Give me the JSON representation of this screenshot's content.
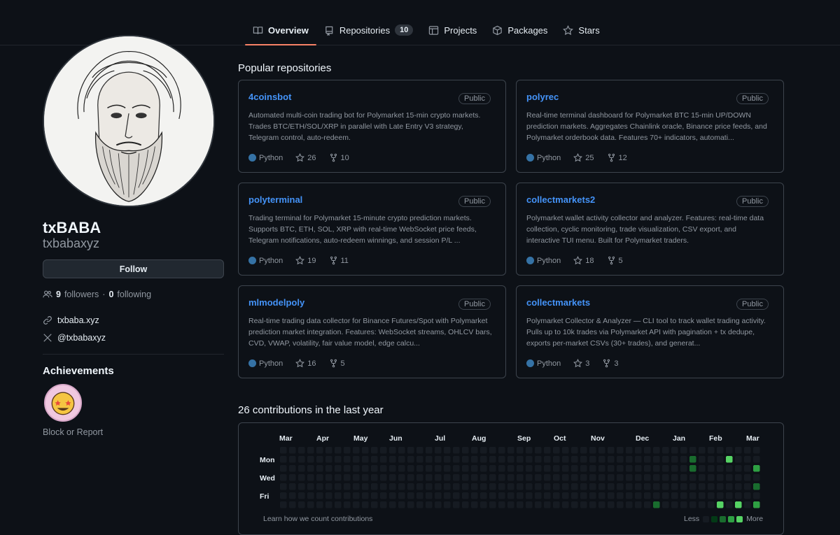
{
  "tabs": [
    {
      "label": "Overview",
      "icon": "book-icon",
      "active": true
    },
    {
      "label": "Repositories",
      "icon": "repo-icon",
      "count": "10"
    },
    {
      "label": "Projects",
      "icon": "table-icon"
    },
    {
      "label": "Packages",
      "icon": "package-icon"
    },
    {
      "label": "Stars",
      "icon": "star-icon"
    }
  ],
  "profile": {
    "name": "txBABA",
    "login": "txbabaxyz",
    "follow_label": "Follow",
    "followers_count": "9",
    "followers_label": "followers",
    "separator": "·",
    "following_count": "0",
    "following_label": "following",
    "website": "txbaba.xyz",
    "twitter": "@txbabaxyz",
    "achievements_title": "Achievements",
    "block_label": "Block or Report"
  },
  "popular_title": "Popular repositories",
  "repos": [
    {
      "name": "4coinsbot",
      "visibility": "Public",
      "description": "Automated multi-coin trading bot for Polymarket 15-min crypto markets. Trades BTC/ETH/SOL/XRP in parallel with Late Entry V3 strategy, Telegram control, auto-redeem.",
      "language": "Python",
      "stars": "26",
      "forks": "10"
    },
    {
      "name": "polyrec",
      "visibility": "Public",
      "description": "Real-time terminal dashboard for Polymarket BTC 15-min UP/DOWN prediction markets. Aggregates Chainlink oracle, Binance price feeds, and Polymarket orderbook data. Features 70+ indicators, automati...",
      "language": "Python",
      "stars": "25",
      "forks": "12"
    },
    {
      "name": "polyterminal",
      "visibility": "Public",
      "description": "Trading terminal for Polymarket 15-minute crypto prediction markets. Supports BTC, ETH, SOL, XRP with real-time WebSocket price feeds, Telegram notifications, auto-redeem winnings, and session P/L ...",
      "language": "Python",
      "stars": "19",
      "forks": "11"
    },
    {
      "name": "collectmarkets2",
      "visibility": "Public",
      "description": "Polymarket wallet activity collector and analyzer. Features: real-time data collection, cyclic monitoring, trade visualization, CSV export, and interactive TUI menu. Built for Polymarket traders.",
      "language": "Python",
      "stars": "18",
      "forks": "5"
    },
    {
      "name": "mlmodelpoly",
      "visibility": "Public",
      "description": "Real-time trading data collector for Binance Futures/Spot with Polymarket prediction market integration. Features: WebSocket streams, OHLCV bars, CVD, VWAP, volatility, fair value model, edge calcu...",
      "language": "Python",
      "stars": "16",
      "forks": "5"
    },
    {
      "name": "collectmarkets",
      "visibility": "Public",
      "description": "Polymarket Collector & Analyzer — CLI tool to track wallet trading activity. Pulls up to 10k trades via Polymarket API with pagination + tx dedupe, exports per-market CSVs (30+ trades), and generat...",
      "language": "Python",
      "stars": "3",
      "forks": "3"
    }
  ],
  "contributions": {
    "title": "26 contributions in the last year",
    "months": [
      "Mar",
      "Apr",
      "May",
      "Jun",
      "Jul",
      "Aug",
      "Sep",
      "Oct",
      "Nov",
      "Dec",
      "Jan",
      "Feb",
      "Mar"
    ],
    "days": [
      "Mon",
      "Wed",
      "Fri"
    ],
    "learn_label": "Learn how we count contributions",
    "less_label": "Less",
    "more_label": "More",
    "colors": [
      "#161b22",
      "#033a16",
      "#196c2e",
      "#2ea043",
      "#56d364"
    ],
    "weeks": 53,
    "cells": [
      {
        "week": 42,
        "day": 6,
        "level": 2
      },
      {
        "week": 46,
        "day": 1,
        "level": 2
      },
      {
        "week": 46,
        "day": 2,
        "level": 2
      },
      {
        "week": 49,
        "day": 6,
        "level": 4
      },
      {
        "week": 50,
        "day": 1,
        "level": 4
      },
      {
        "week": 51,
        "day": 6,
        "level": 4
      },
      {
        "week": 53,
        "day": 2,
        "level": 3
      },
      {
        "week": 53,
        "day": 4,
        "level": 2
      },
      {
        "week": 53,
        "day": 6,
        "level": 3
      }
    ]
  },
  "language_color": "#3572a5",
  "accent_color": "#f78166",
  "link_color": "#4493f8"
}
